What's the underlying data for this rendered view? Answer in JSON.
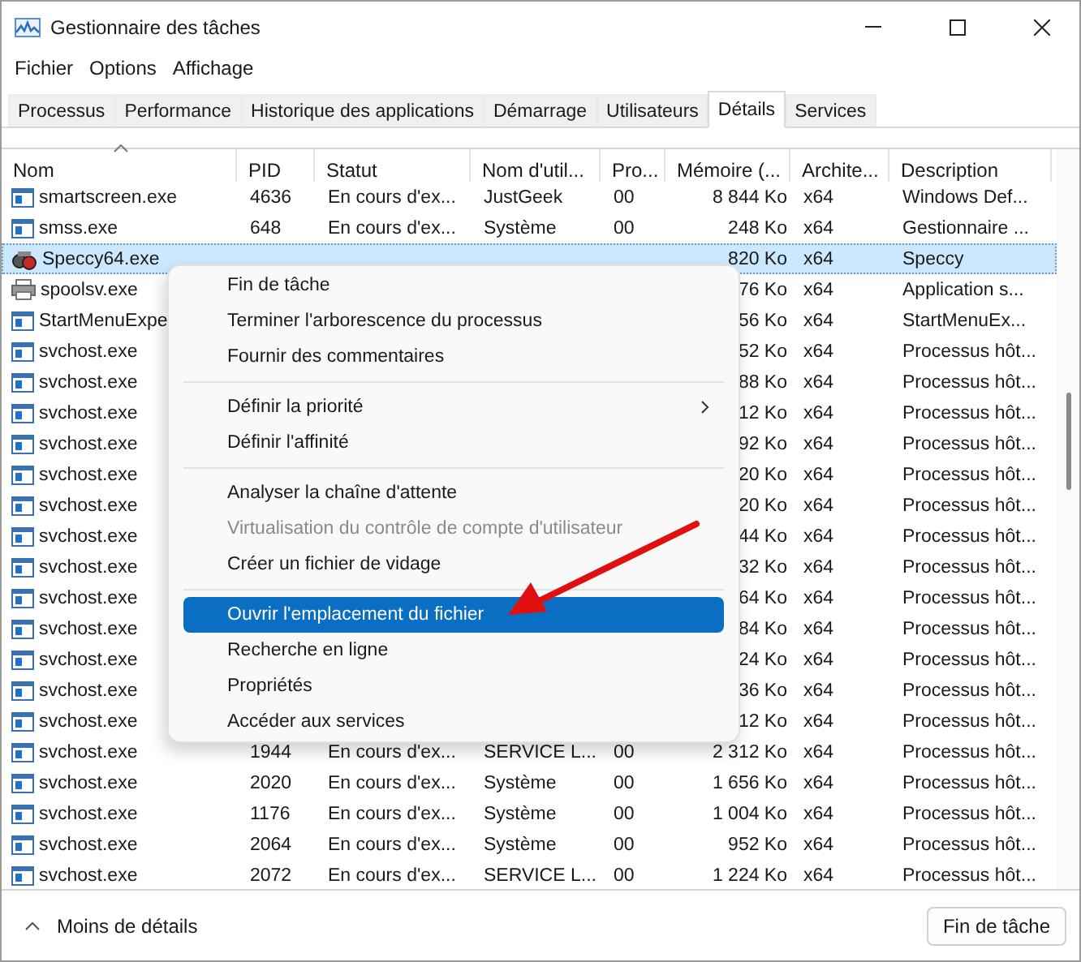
{
  "window": {
    "title": "Gestionnaire des tâches"
  },
  "menu_bar": [
    "Fichier",
    "Options",
    "Affichage"
  ],
  "tabs": [
    {
      "label": "Processus",
      "selected": false
    },
    {
      "label": "Performance",
      "selected": false
    },
    {
      "label": "Historique des applications",
      "selected": false
    },
    {
      "label": "Démarrage",
      "selected": false
    },
    {
      "label": "Utilisateurs",
      "selected": false
    },
    {
      "label": "Détails",
      "selected": true
    },
    {
      "label": "Services",
      "selected": false
    }
  ],
  "table": {
    "columns": [
      "Nom",
      "PID",
      "Statut",
      "Nom d'util...",
      "Pro...",
      "Mémoire (...",
      "Archite...",
      "Description"
    ],
    "rows": [
      {
        "kind": "window",
        "selected": false,
        "cells": [
          "smartscreen.exe",
          "4636",
          "En cours d'ex...",
          "JustGeek",
          "00",
          "8 844 Ko",
          "x64",
          "Windows Def..."
        ]
      },
      {
        "kind": "window",
        "selected": false,
        "cells": [
          "smss.exe",
          "648",
          "En cours d'ex...",
          "Système",
          "00",
          "248 Ko",
          "x64",
          "Gestionnaire ..."
        ]
      },
      {
        "kind": "speccy",
        "selected": true,
        "cells": [
          "Speccy64.exe",
          null,
          null,
          null,
          null,
          "820 Ko",
          "x64",
          "Speccy"
        ]
      },
      {
        "kind": "printer",
        "selected": false,
        "cells": [
          "spoolsv.exe",
          null,
          null,
          null,
          null,
          "76 Ko",
          "x64",
          "Application s..."
        ]
      },
      {
        "kind": "window",
        "selected": false,
        "cells": [
          "StartMenuExpe",
          null,
          null,
          null,
          null,
          "56 Ko",
          "x64",
          "StartMenuEx..."
        ]
      },
      {
        "kind": "window",
        "selected": false,
        "cells": [
          "svchost.exe",
          null,
          null,
          null,
          null,
          "52 Ko",
          "x64",
          "Processus hôt..."
        ]
      },
      {
        "kind": "window",
        "selected": false,
        "cells": [
          "svchost.exe",
          null,
          null,
          null,
          null,
          "88 Ko",
          "x64",
          "Processus hôt..."
        ]
      },
      {
        "kind": "window",
        "selected": false,
        "cells": [
          "svchost.exe",
          null,
          null,
          null,
          null,
          "12 Ko",
          "x64",
          "Processus hôt..."
        ]
      },
      {
        "kind": "window",
        "selected": false,
        "cells": [
          "svchost.exe",
          null,
          null,
          null,
          null,
          "92 Ko",
          "x64",
          "Processus hôt..."
        ]
      },
      {
        "kind": "window",
        "selected": false,
        "cells": [
          "svchost.exe",
          null,
          null,
          null,
          null,
          "20 Ko",
          "x64",
          "Processus hôt..."
        ]
      },
      {
        "kind": "window",
        "selected": false,
        "cells": [
          "svchost.exe",
          null,
          null,
          null,
          null,
          "20 Ko",
          "x64",
          "Processus hôt..."
        ]
      },
      {
        "kind": "window",
        "selected": false,
        "cells": [
          "svchost.exe",
          null,
          null,
          null,
          null,
          "44 Ko",
          "x64",
          "Processus hôt..."
        ]
      },
      {
        "kind": "window",
        "selected": false,
        "cells": [
          "svchost.exe",
          null,
          null,
          null,
          null,
          "32 Ko",
          "x64",
          "Processus hôt..."
        ]
      },
      {
        "kind": "window",
        "selected": false,
        "cells": [
          "svchost.exe",
          null,
          null,
          null,
          null,
          "64 Ko",
          "x64",
          "Processus hôt..."
        ]
      },
      {
        "kind": "window",
        "selected": false,
        "cells": [
          "svchost.exe",
          null,
          null,
          null,
          null,
          "84 Ko",
          "x64",
          "Processus hôt..."
        ]
      },
      {
        "kind": "window",
        "selected": false,
        "cells": [
          "svchost.exe",
          null,
          null,
          null,
          null,
          "24 Ko",
          "x64",
          "Processus hôt..."
        ]
      },
      {
        "kind": "window",
        "selected": false,
        "cells": [
          "svchost.exe",
          null,
          null,
          null,
          null,
          "36 Ko",
          "x64",
          "Processus hôt..."
        ]
      },
      {
        "kind": "window",
        "selected": false,
        "cells": [
          "svchost.exe",
          null,
          null,
          null,
          null,
          "12 Ko",
          "x64",
          "Processus hôt..."
        ]
      },
      {
        "kind": "window",
        "selected": false,
        "cells": [
          "svchost.exe",
          "1944",
          "En cours d'ex...",
          "SERVICE L...",
          "00",
          "2 312 Ko",
          "x64",
          "Processus hôt..."
        ]
      },
      {
        "kind": "window",
        "selected": false,
        "cells": [
          "svchost.exe",
          "2020",
          "En cours d'ex...",
          "Système",
          "00",
          "1 656 Ko",
          "x64",
          "Processus hôt..."
        ]
      },
      {
        "kind": "window",
        "selected": false,
        "cells": [
          "svchost.exe",
          "1176",
          "En cours d'ex...",
          "Système",
          "00",
          "1 004 Ko",
          "x64",
          "Processus hôt..."
        ]
      },
      {
        "kind": "window",
        "selected": false,
        "cells": [
          "svchost.exe",
          "2064",
          "En cours d'ex...",
          "Système",
          "00",
          "952 Ko",
          "x64",
          "Processus hôt..."
        ]
      },
      {
        "kind": "window",
        "selected": false,
        "cells": [
          "svchost.exe",
          "2072",
          "En cours d'ex...",
          "SERVICE L...",
          "00",
          "1 224 Ko",
          "x64",
          "Processus hôt..."
        ]
      }
    ]
  },
  "context_menu": [
    {
      "kind": "item",
      "label": "Fin de tâche",
      "disabled": false,
      "selected": false,
      "submenu": false
    },
    {
      "kind": "item",
      "label": "Terminer l'arborescence du processus",
      "disabled": false,
      "selected": false,
      "submenu": false
    },
    {
      "kind": "item",
      "label": "Fournir des commentaires",
      "disabled": false,
      "selected": false,
      "submenu": false
    },
    {
      "kind": "separator"
    },
    {
      "kind": "item",
      "label": "Définir la priorité",
      "disabled": false,
      "selected": false,
      "submenu": true
    },
    {
      "kind": "item",
      "label": "Définir l'affinité",
      "disabled": false,
      "selected": false,
      "submenu": false
    },
    {
      "kind": "separator"
    },
    {
      "kind": "item",
      "label": "Analyser la chaîne d'attente",
      "disabled": false,
      "selected": false,
      "submenu": false
    },
    {
      "kind": "item",
      "label": "Virtualisation du contrôle de compte d'utilisateur",
      "disabled": true,
      "selected": false,
      "submenu": false
    },
    {
      "kind": "item",
      "label": "Créer un fichier de vidage",
      "disabled": false,
      "selected": false,
      "submenu": false
    },
    {
      "kind": "separator"
    },
    {
      "kind": "item",
      "label": "Ouvrir l'emplacement du fichier",
      "disabled": false,
      "selected": true,
      "submenu": false
    },
    {
      "kind": "item",
      "label": "Recherche en ligne",
      "disabled": false,
      "selected": false,
      "submenu": false
    },
    {
      "kind": "item",
      "label": "Propriétés",
      "disabled": false,
      "selected": false,
      "submenu": false
    },
    {
      "kind": "item",
      "label": "Accéder aux services",
      "disabled": false,
      "selected": false,
      "submenu": false
    }
  ],
  "footer": {
    "toggle": "Moins de détails",
    "button": "Fin de tâche"
  }
}
